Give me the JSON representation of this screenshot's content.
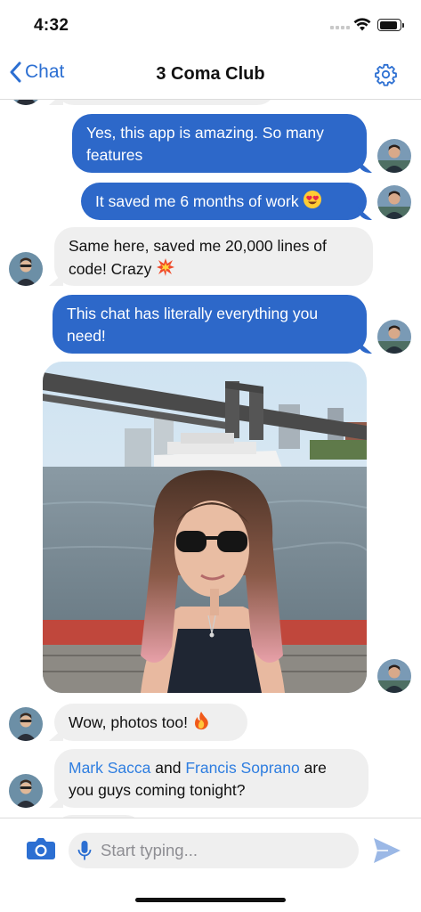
{
  "status_bar": {
    "time": "4:32",
    "icons": [
      "signal-icon",
      "wifi-icon",
      "battery-icon"
    ]
  },
  "nav": {
    "back_label": "Chat",
    "title": "3 Coma Club",
    "back_icon": "chevron-left-icon",
    "settings_icon": "gear-icon"
  },
  "messages": [
    {
      "direction": "outgoing",
      "text": "Yes, this app is amazing. So many features"
    },
    {
      "direction": "outgoing",
      "text": "It saved me 6 months of work",
      "emoji": "heart-eyes-emoji"
    },
    {
      "direction": "incoming",
      "text": "Same here, saved me 20,000 lines of code! Crazy",
      "emoji": "collision-emoji"
    },
    {
      "direction": "outgoing",
      "text": "This chat has literally everything you need!"
    },
    {
      "direction": "outgoing",
      "type": "photo",
      "subject": "woman-on-boat-bridge-photo"
    },
    {
      "direction": "incoming",
      "text": "Wow, photos too!",
      "emoji": "fire-emoji"
    },
    {
      "direction": "incoming",
      "mention_1": "Mark Sacca",
      "text_between": " and ",
      "mention_2": "Francis Soprano",
      "text_after": " are you guys coming tonight?"
    }
  ],
  "composer": {
    "placeholder": "Start typing...",
    "camera_icon": "camera-icon",
    "mic_icon": "microphone-icon",
    "send_icon": "send-icon"
  },
  "colors": {
    "accent": "#2c6fd2",
    "outgoing_bubble": "#2d68c9",
    "incoming_bubble": "#efefef",
    "mention": "#2f7ee0",
    "send_inactive": "#9bb8e6"
  }
}
